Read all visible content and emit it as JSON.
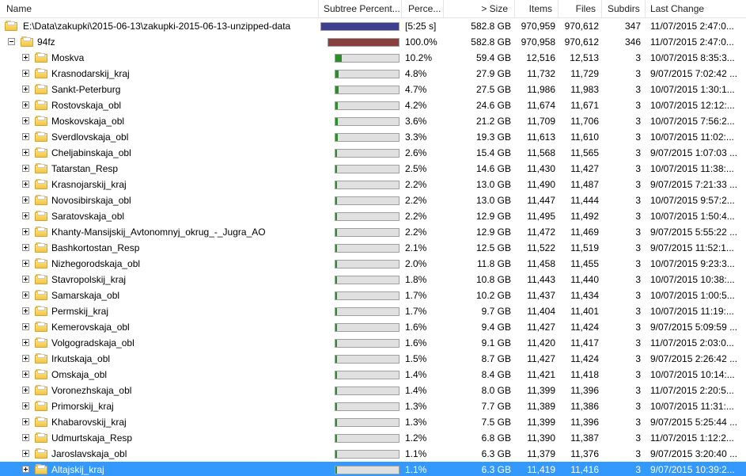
{
  "columns": {
    "name": "Name",
    "subtree_percent": "Subtree Percent...",
    "percent": "Perce...",
    "size": "> Size",
    "items": "Items",
    "files": "Files",
    "subdirs": "Subdirs",
    "last_change": "Last Change"
  },
  "colors": {
    "root_bar": "#3f3f8f",
    "folder_bar": "#8a3f3f",
    "child_bar": "#2e8b2e",
    "selection": "#3399ff"
  },
  "rows": [
    {
      "name": "E:\\Data\\zakupki\\2015-06-13\\zakupki-2015-06-13-unzipped-data",
      "level": 0,
      "expander": "none",
      "fill": 1.0,
      "bar_color": "root",
      "percent": "[5:25 s]",
      "size": "582.8 GB",
      "items": "970,959",
      "files": "970,612",
      "subdirs": "347",
      "last_change": "11/07/2015  2:47:0..."
    },
    {
      "name": "94fz",
      "level": 1,
      "expander": "minus",
      "fill": 1.0,
      "bar_color": "folder",
      "percent": "100.0%",
      "size": "582.8 GB",
      "items": "970,958",
      "files": "970,612",
      "subdirs": "346",
      "last_change": "11/07/2015  2:47:0..."
    },
    {
      "name": "Moskva",
      "level": 2,
      "expander": "plus",
      "fill": 0.102,
      "bar_color": "child",
      "percent": "10.2%",
      "size": "59.4 GB",
      "items": "12,516",
      "files": "12,513",
      "subdirs": "3",
      "last_change": "10/07/2015  8:35:3..."
    },
    {
      "name": "Krasnodarskij_kraj",
      "level": 2,
      "expander": "plus",
      "fill": 0.048,
      "bar_color": "child",
      "percent": "4.8%",
      "size": "27.9 GB",
      "items": "11,732",
      "files": "11,729",
      "subdirs": "3",
      "last_change": "9/07/2015  7:02:42 ..."
    },
    {
      "name": "Sankt-Peterburg",
      "level": 2,
      "expander": "plus",
      "fill": 0.047,
      "bar_color": "child",
      "percent": "4.7%",
      "size": "27.5 GB",
      "items": "11,986",
      "files": "11,983",
      "subdirs": "3",
      "last_change": "10/07/2015  1:30:1..."
    },
    {
      "name": "Rostovskaja_obl",
      "level": 2,
      "expander": "plus",
      "fill": 0.042,
      "bar_color": "child",
      "percent": "4.2%",
      "size": "24.6 GB",
      "items": "11,674",
      "files": "11,671",
      "subdirs": "3",
      "last_change": "10/07/2015  12:12:..."
    },
    {
      "name": "Moskovskaja_obl",
      "level": 2,
      "expander": "plus",
      "fill": 0.036,
      "bar_color": "child",
      "percent": "3.6%",
      "size": "21.2 GB",
      "items": "11,709",
      "files": "11,706",
      "subdirs": "3",
      "last_change": "10/07/2015  7:56:2..."
    },
    {
      "name": "Sverdlovskaja_obl",
      "level": 2,
      "expander": "plus",
      "fill": 0.033,
      "bar_color": "child",
      "percent": "3.3%",
      "size": "19.3 GB",
      "items": "11,613",
      "files": "11,610",
      "subdirs": "3",
      "last_change": "10/07/2015  11:02:..."
    },
    {
      "name": "Cheljabinskaja_obl",
      "level": 2,
      "expander": "plus",
      "fill": 0.026,
      "bar_color": "child",
      "percent": "2.6%",
      "size": "15.4 GB",
      "items": "11,568",
      "files": "11,565",
      "subdirs": "3",
      "last_change": "9/07/2015  1:07:03 ..."
    },
    {
      "name": "Tatarstan_Resp",
      "level": 2,
      "expander": "plus",
      "fill": 0.025,
      "bar_color": "child",
      "percent": "2.5%",
      "size": "14.6 GB",
      "items": "11,430",
      "files": "11,427",
      "subdirs": "3",
      "last_change": "10/07/2015  11:38:..."
    },
    {
      "name": "Krasnojarskij_kraj",
      "level": 2,
      "expander": "plus",
      "fill": 0.022,
      "bar_color": "child",
      "percent": "2.2%",
      "size": "13.0 GB",
      "items": "11,490",
      "files": "11,487",
      "subdirs": "3",
      "last_change": "9/07/2015  7:21:33 ..."
    },
    {
      "name": "Novosibirskaja_obl",
      "level": 2,
      "expander": "plus",
      "fill": 0.022,
      "bar_color": "child",
      "percent": "2.2%",
      "size": "13.0 GB",
      "items": "11,447",
      "files": "11,444",
      "subdirs": "3",
      "last_change": "10/07/2015  9:57:2..."
    },
    {
      "name": "Saratovskaja_obl",
      "level": 2,
      "expander": "plus",
      "fill": 0.022,
      "bar_color": "child",
      "percent": "2.2%",
      "size": "12.9 GB",
      "items": "11,495",
      "files": "11,492",
      "subdirs": "3",
      "last_change": "10/07/2015  1:50:4..."
    },
    {
      "name": "Khanty-Mansijskij_Avtonomnyj_okrug_-_Jugra_AO",
      "level": 2,
      "expander": "plus",
      "fill": 0.022,
      "bar_color": "child",
      "percent": "2.2%",
      "size": "12.9 GB",
      "items": "11,472",
      "files": "11,469",
      "subdirs": "3",
      "last_change": "9/07/2015  5:55:22 ..."
    },
    {
      "name": "Bashkortostan_Resp",
      "level": 2,
      "expander": "plus",
      "fill": 0.021,
      "bar_color": "child",
      "percent": "2.1%",
      "size": "12.5 GB",
      "items": "11,522",
      "files": "11,519",
      "subdirs": "3",
      "last_change": "9/07/2015  11:52:1..."
    },
    {
      "name": "Nizhegorodskaja_obl",
      "level": 2,
      "expander": "plus",
      "fill": 0.02,
      "bar_color": "child",
      "percent": "2.0%",
      "size": "11.8 GB",
      "items": "11,458",
      "files": "11,455",
      "subdirs": "3",
      "last_change": "10/07/2015  9:23:3..."
    },
    {
      "name": "Stavropolskij_kraj",
      "level": 2,
      "expander": "plus",
      "fill": 0.018,
      "bar_color": "child",
      "percent": "1.8%",
      "size": "10.8 GB",
      "items": "11,443",
      "files": "11,440",
      "subdirs": "3",
      "last_change": "10/07/2015  10:38:..."
    },
    {
      "name": "Samarskaja_obl",
      "level": 2,
      "expander": "plus",
      "fill": 0.017,
      "bar_color": "child",
      "percent": "1.7%",
      "size": "10.2 GB",
      "items": "11,437",
      "files": "11,434",
      "subdirs": "3",
      "last_change": "10/07/2015  1:00:5..."
    },
    {
      "name": "Permskij_kraj",
      "level": 2,
      "expander": "plus",
      "fill": 0.017,
      "bar_color": "child",
      "percent": "1.7%",
      "size": "9.7 GB",
      "items": "11,404",
      "files": "11,401",
      "subdirs": "3",
      "last_change": "10/07/2015  11:19:..."
    },
    {
      "name": "Kemerovskaja_obl",
      "level": 2,
      "expander": "plus",
      "fill": 0.016,
      "bar_color": "child",
      "percent": "1.6%",
      "size": "9.4 GB",
      "items": "11,427",
      "files": "11,424",
      "subdirs": "3",
      "last_change": "9/07/2015  5:09:59 ..."
    },
    {
      "name": "Volgogradskaja_obl",
      "level": 2,
      "expander": "plus",
      "fill": 0.016,
      "bar_color": "child",
      "percent": "1.6%",
      "size": "9.1 GB",
      "items": "11,420",
      "files": "11,417",
      "subdirs": "3",
      "last_change": "11/07/2015  2:03:0..."
    },
    {
      "name": "Irkutskaja_obl",
      "level": 2,
      "expander": "plus",
      "fill": 0.015,
      "bar_color": "child",
      "percent": "1.5%",
      "size": "8.7 GB",
      "items": "11,427",
      "files": "11,424",
      "subdirs": "3",
      "last_change": "9/07/2015  2:26:42 ..."
    },
    {
      "name": "Omskaja_obl",
      "level": 2,
      "expander": "plus",
      "fill": 0.014,
      "bar_color": "child",
      "percent": "1.4%",
      "size": "8.4 GB",
      "items": "11,421",
      "files": "11,418",
      "subdirs": "3",
      "last_change": "10/07/2015  10:14:..."
    },
    {
      "name": "Voronezhskaja_obl",
      "level": 2,
      "expander": "plus",
      "fill": 0.014,
      "bar_color": "child",
      "percent": "1.4%",
      "size": "8.0 GB",
      "items": "11,399",
      "files": "11,396",
      "subdirs": "3",
      "last_change": "11/07/2015  2:20:5..."
    },
    {
      "name": "Primorskij_kraj",
      "level": 2,
      "expander": "plus",
      "fill": 0.013,
      "bar_color": "child",
      "percent": "1.3%",
      "size": "7.7 GB",
      "items": "11,389",
      "files": "11,386",
      "subdirs": "3",
      "last_change": "10/07/2015  11:31:..."
    },
    {
      "name": "Khabarovskij_kraj",
      "level": 2,
      "expander": "plus",
      "fill": 0.013,
      "bar_color": "child",
      "percent": "1.3%",
      "size": "7.5 GB",
      "items": "11,399",
      "files": "11,396",
      "subdirs": "3",
      "last_change": "9/07/2015  5:25:44 ..."
    },
    {
      "name": "Udmurtskaja_Resp",
      "level": 2,
      "expander": "plus",
      "fill": 0.012,
      "bar_color": "child",
      "percent": "1.2%",
      "size": "6.8 GB",
      "items": "11,390",
      "files": "11,387",
      "subdirs": "3",
      "last_change": "11/07/2015  1:12:2..."
    },
    {
      "name": "Jaroslavskaja_obl",
      "level": 2,
      "expander": "plus",
      "fill": 0.011,
      "bar_color": "child",
      "percent": "1.1%",
      "size": "6.3 GB",
      "items": "11,379",
      "files": "11,376",
      "subdirs": "3",
      "last_change": "9/07/2015  3:20:40 ..."
    },
    {
      "name": "Altajskij_kraj",
      "level": 2,
      "expander": "plus",
      "fill": 0.011,
      "bar_color": "child",
      "percent": "1.1%",
      "size": "6.3 GB",
      "items": "11,419",
      "files": "11,416",
      "subdirs": "3",
      "last_change": "9/07/2015  10:39:2...",
      "selected": true
    }
  ]
}
